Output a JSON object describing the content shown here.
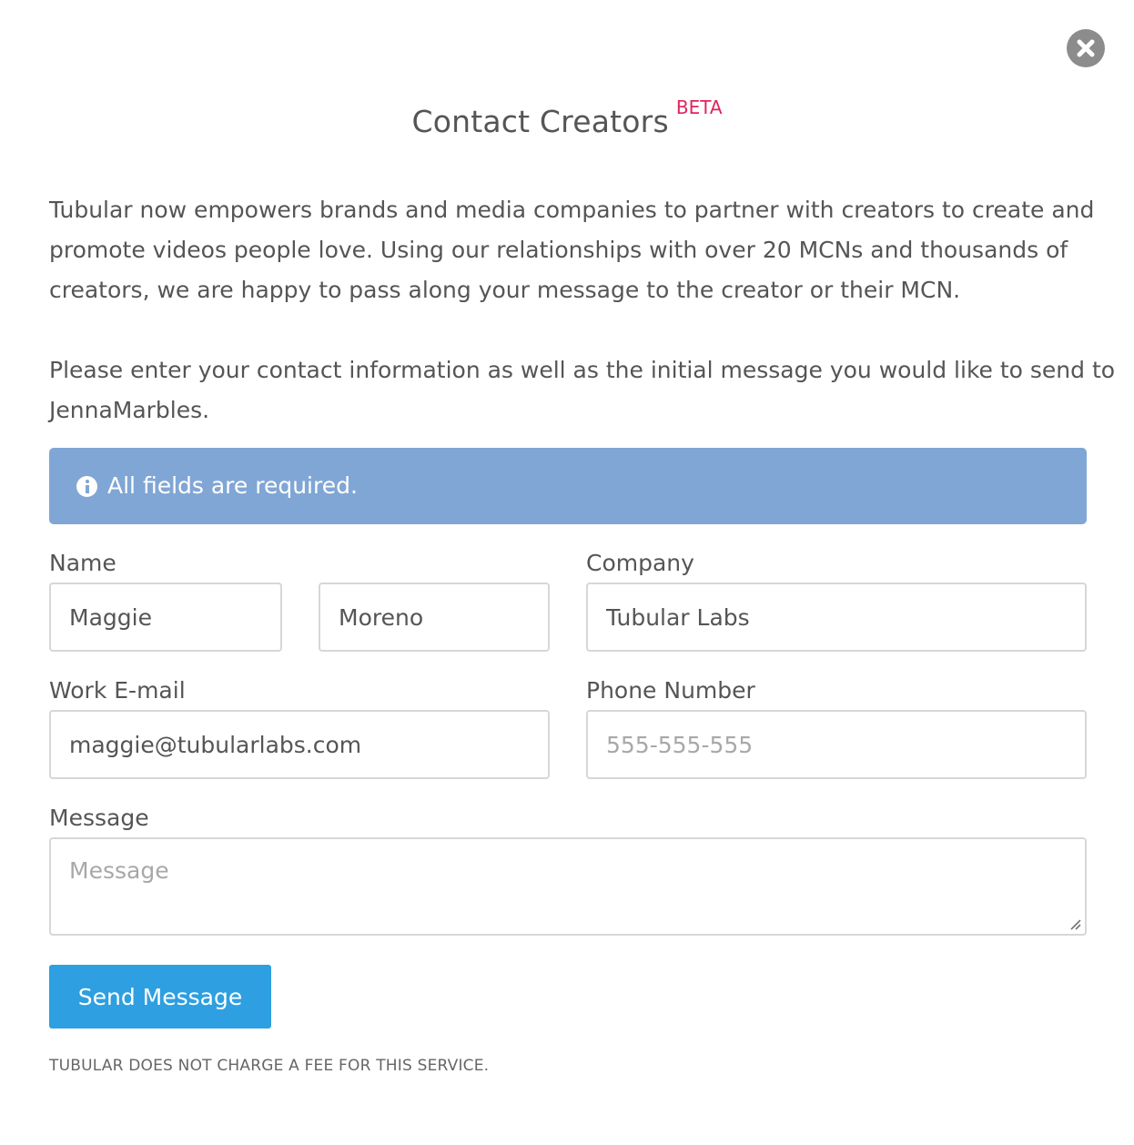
{
  "colors": {
    "accent_pink": "#e0245e",
    "alert_bg": "#80a6d5",
    "button_bg": "#2e9fe0",
    "close_bg": "#8c8c8c"
  },
  "close": {
    "icon": "close-icon"
  },
  "header": {
    "title": "Contact Creators",
    "badge": "BETA"
  },
  "intro": {
    "lines": [
      "Tubular now empowers brands and media companies to partner with creators to create and",
      "promote videos people love. Using our relationships with over 20 MCNs and thousands of",
      "creators, we are happy to pass along your message to the creator or their MCN."
    ]
  },
  "instruction": {
    "lines": [
      "Please enter your contact information as well as the initial message you would like to send to",
      "JennaMarbles."
    ]
  },
  "alert": {
    "icon": "info-icon",
    "text": "All fields are required."
  },
  "form": {
    "name_label": "Name",
    "first_name_value": "Maggie",
    "last_name_value": "Moreno",
    "company_label": "Company",
    "company_value": "Tubular Labs",
    "email_label": "Work E-mail",
    "email_value": "maggie@tubularlabs.com",
    "phone_label": "Phone Number",
    "phone_value": "",
    "phone_placeholder": "555-555-555",
    "message_label": "Message",
    "message_value": "",
    "message_placeholder": "Message",
    "submit_label": "Send Message"
  },
  "footer": {
    "disclaimer": "TUBULAR DOES NOT CHARGE A FEE FOR THIS SERVICE."
  }
}
